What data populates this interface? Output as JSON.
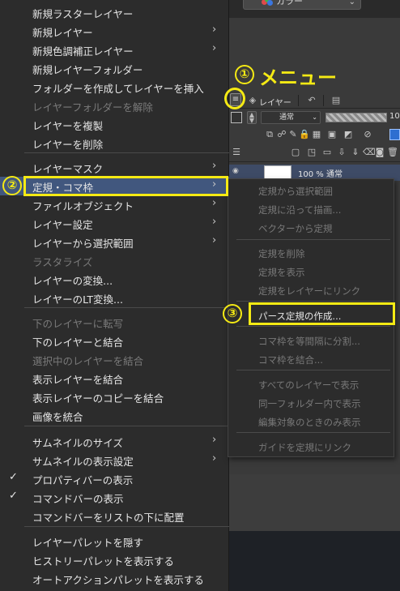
{
  "top": {
    "color_dropdown": "カラー",
    "color_dots": [
      "#e04a4a",
      "#3fb24a",
      "#3a76e0"
    ]
  },
  "layer_palette": {
    "menu_button": "≡",
    "tab_layer": "レイヤー",
    "blend_mode": "通常",
    "opacity_value": "10",
    "layer_name": "100 % 通常",
    "accent": "#2e6fd1"
  },
  "menu": {
    "items": [
      {
        "label": "新規ラスターレイヤー",
        "arrow": false
      },
      {
        "label": "新規レイヤー",
        "arrow": true
      },
      {
        "label": "新規色調補正レイヤー",
        "arrow": true
      },
      {
        "label": "新規レイヤーフォルダー",
        "arrow": false
      },
      {
        "label": "フォルダーを作成してレイヤーを挿入",
        "arrow": false
      },
      {
        "label": "レイヤーフォルダーを解除",
        "arrow": false,
        "disabled": true
      },
      {
        "label": "レイヤーを複製",
        "arrow": false
      },
      {
        "label": "レイヤーを削除",
        "arrow": false
      },
      {
        "label": "レイヤーマスク",
        "arrow": true
      },
      {
        "label": "定規・コマ枠",
        "arrow": true,
        "selected": true
      },
      {
        "label": "ファイルオブジェクト",
        "arrow": true
      },
      {
        "label": "レイヤー設定",
        "arrow": true
      },
      {
        "label": "レイヤーから選択範囲",
        "arrow": true
      },
      {
        "label": "ラスタライズ",
        "arrow": false,
        "disabled": true
      },
      {
        "label": "レイヤーの変換...",
        "arrow": false
      },
      {
        "label": "レイヤーのLT変換...",
        "arrow": false
      },
      {
        "label": "下のレイヤーに転写",
        "arrow": false,
        "disabled": true
      },
      {
        "label": "下のレイヤーと結合",
        "arrow": false
      },
      {
        "label": "選択中のレイヤーを結合",
        "arrow": false,
        "disabled": true
      },
      {
        "label": "表示レイヤーを結合",
        "arrow": false
      },
      {
        "label": "表示レイヤーのコピーを結合",
        "arrow": false
      },
      {
        "label": "画像を統合",
        "arrow": false
      },
      {
        "label": "サムネイルのサイズ",
        "arrow": true
      },
      {
        "label": "サムネイルの表示設定",
        "arrow": true
      },
      {
        "label": "プロパティバーの表示",
        "arrow": false,
        "checked": true
      },
      {
        "label": "コマンドバーの表示",
        "arrow": false,
        "checked": true
      },
      {
        "label": "コマンドバーをリストの下に配置",
        "arrow": false
      },
      {
        "label": "レイヤーパレットを隠す",
        "arrow": false
      },
      {
        "label": "ヒストリーパレットを表示する",
        "arrow": false
      },
      {
        "label": "オートアクションパレットを表示する",
        "arrow": false
      }
    ]
  },
  "submenu": {
    "items": [
      {
        "label": "定規から選択範囲",
        "disabled": true
      },
      {
        "label": "定規に沿って描画...",
        "disabled": true
      },
      {
        "label": "ベクターから定規",
        "disabled": true
      },
      {
        "label": "定規を削除",
        "disabled": true
      },
      {
        "label": "定規を表示",
        "disabled": true
      },
      {
        "label": "定規をレイヤーにリンク",
        "disabled": true
      },
      {
        "label": "パース定規の作成...",
        "disabled": false
      },
      {
        "label": "コマ枠を等間隔に分割...",
        "disabled": true
      },
      {
        "label": "コマ枠を結合...",
        "disabled": true
      },
      {
        "label": "すべてのレイヤーで表示",
        "disabled": true
      },
      {
        "label": "同一フォルダー内で表示",
        "disabled": true
      },
      {
        "label": "編集対象のときのみ表示",
        "disabled": true
      },
      {
        "label": "ガイドを定規にリンク",
        "disabled": true
      }
    ]
  },
  "annotations": {
    "step1_num": "①",
    "step1_text": "メニュー",
    "step2_num": "②",
    "step3_num": "③",
    "highlight_color": "#f5ea14"
  }
}
